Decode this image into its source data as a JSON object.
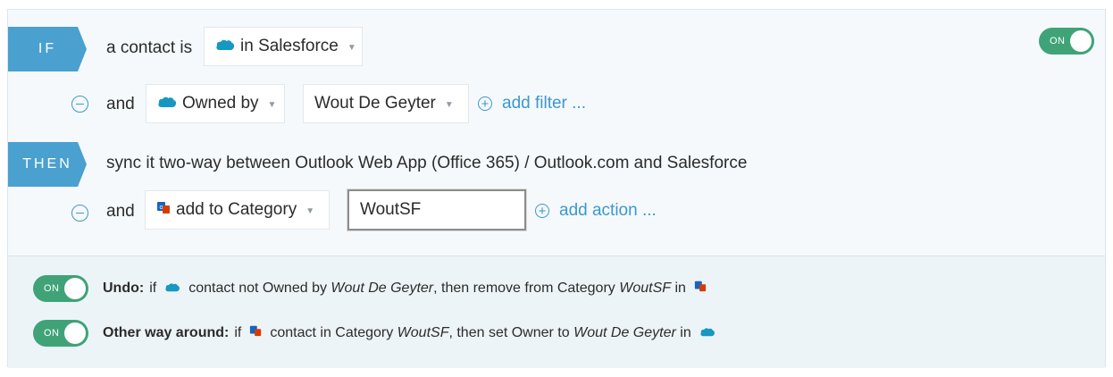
{
  "rule": {
    "enabled_label": "ON",
    "if_tag": "IF",
    "then_tag": "THEN",
    "condition_prefix": "a contact is",
    "condition_value": "in Salesforce",
    "filter_and": "and",
    "filter_field": "Owned by",
    "filter_value": "Wout De Geyter",
    "add_filter": "add filter ...",
    "then_text": "sync it two-way between Outlook Web App (Office 365) / Outlook.com and Salesforce",
    "action_and": "and",
    "action_field": "add to Category",
    "action_value": "WoutSF",
    "add_action": "add action ..."
  },
  "undo": {
    "toggle_label": "ON",
    "title": "Undo:",
    "if": "if",
    "text1": "contact not Owned by",
    "owner": "Wout De Geyter",
    "text2": ", then remove from Category",
    "category": "WoutSF",
    "text3": "in"
  },
  "reverse": {
    "toggle_label": "ON",
    "title": "Other way around:",
    "if": "if",
    "text1": "contact in Category",
    "category": "WoutSF",
    "text2": ", then set Owner to",
    "owner": "Wout De Geyter",
    "text3": "in"
  },
  "icons": {
    "salesforce": "salesforce-cloud-icon",
    "outlook": "outlook-icon"
  },
  "colors": {
    "accent": "#4aa0cf",
    "link": "#3c98cc",
    "toggle_on": "#3fa377",
    "salesforce": "#1798c1",
    "office": "#d83b01"
  }
}
